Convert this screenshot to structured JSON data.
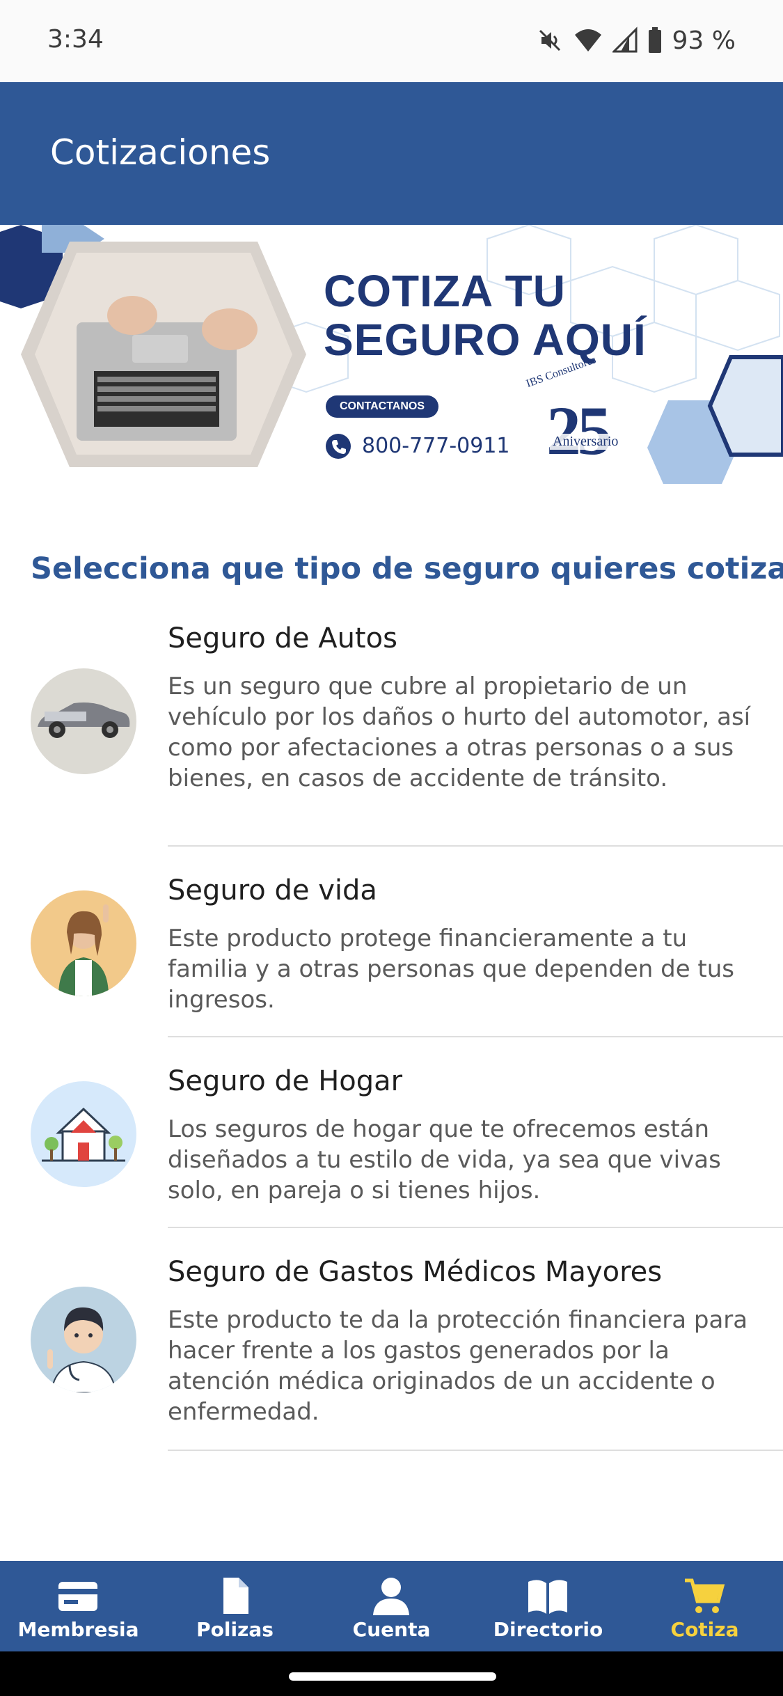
{
  "status_bar": {
    "time": "3:34",
    "battery": "93 %",
    "icons": [
      "mute-icon",
      "wifi-icon",
      "signal-icon",
      "battery-icon"
    ]
  },
  "app_bar": {
    "title": "Cotizaciones"
  },
  "banner": {
    "headline_line1": "COTIZA TU",
    "headline_line2": "SEGURO AQUÍ",
    "contact_label": "CONTACTANOS",
    "phone": "800-777-0911",
    "brand": "IBS Consultores",
    "anniversary_number": "25",
    "anniversary_word": "Aniversario"
  },
  "section_heading": "Selecciona que tipo de seguro quieres cotizar",
  "insurance_items": [
    {
      "title": "Seguro de Autos",
      "description": "Es un seguro que cubre al propietario de un vehículo por los daños o hurto del automotor, así como por afectaciones a otras personas o a sus bienes, en casos de accidente de tránsito.",
      "icon": "car-icon"
    },
    {
      "title": "Seguro de vida",
      "description": "Este producto protege financieramente a tu familia y a otras personas que dependen de tus ingresos.",
      "icon": "person-icon"
    },
    {
      "title": "Seguro de Hogar",
      "description": "Los seguros de hogar que te ofrecemos están diseñados a tu estilo de vida, ya sea que vivas solo, en pareja o si tienes hijos.",
      "icon": "house-icon"
    },
    {
      "title": "Seguro de Gastos Médicos Mayores",
      "description": "Este producto te da la protección financiera para hacer frente a los gastos generados por la atención médica originados de un accidente o enfermedad.",
      "icon": "doctor-icon"
    }
  ],
  "bottom_nav": [
    {
      "label": "Membresia",
      "icon": "card-icon",
      "active": false
    },
    {
      "label": "Polizas",
      "icon": "document-icon",
      "active": false
    },
    {
      "label": "Cuenta",
      "icon": "user-icon",
      "active": false
    },
    {
      "label": "Directorio",
      "icon": "book-icon",
      "active": false
    },
    {
      "label": "Cotiza",
      "icon": "cart-icon",
      "active": true
    }
  ],
  "colors": {
    "primary": "#2f5896",
    "banner_navy": "#1f3775",
    "active_nav": "#f6d13e",
    "description_text": "#5a5a5a"
  }
}
